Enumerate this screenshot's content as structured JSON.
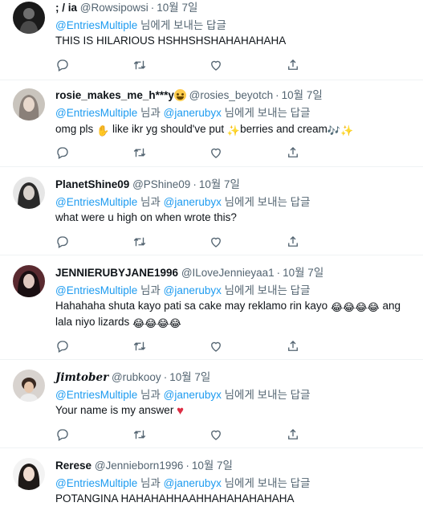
{
  "tweets": [
    {
      "name": "; / ia",
      "handle": "@Rowsipowsi",
      "date": "10월 7일",
      "reply_prefix": "",
      "reply_user1": "@EntriesMultiple",
      "reply_mid": "",
      "reply_user2": "",
      "reply_suffix": "님에게 보내는 답글",
      "text": "THIS IS HILARIOUS HSHHSHSHAHAHAHAHA"
    },
    {
      "name": "rosie_makes_me_h***y",
      "name_emoji": "grinning-sweat-emoji",
      "handle": "@rosies_beyotch",
      "date": "10월 7일",
      "reply_user1": "@EntriesMultiple",
      "reply_mid": "님과",
      "reply_user2": "@janerubyx",
      "reply_suffix": "님에게 보내는 답글",
      "text_a": "omg pls",
      "text_b": "like ikr yg should've put",
      "text_c": "berries and cream"
    },
    {
      "name": "PlanetShine09",
      "handle": "@PShine09",
      "date": "10월 7일",
      "reply_user1": "@EntriesMultiple",
      "reply_mid": "님과",
      "reply_user2": "@janerubyx",
      "reply_suffix": "님에게 보내는 답글",
      "text": "what were u high on when wrote this?"
    },
    {
      "name": "JENNIERUBYJANE1996",
      "handle": "@ILoveJennieyaa1",
      "date": "10월 7일",
      "reply_user1": "@EntriesMultiple",
      "reply_mid": "님과",
      "reply_user2": "@janerubyx",
      "reply_suffix": "님에게 보내는 답글",
      "text_a": "Hahahaha shuta kayo pati sa cake may reklamo rin kayo",
      "text_b": "ang",
      "text_c": "lala niyo lizards"
    },
    {
      "name": "𝑱𝒊𝒎𝒕𝒐𝒃𝒆𝒓",
      "handle": "@rubkooy",
      "date": "10월 7일",
      "reply_user1": "@EntriesMultiple",
      "reply_mid": "님과",
      "reply_user2": "@janerubyx",
      "reply_suffix": "님에게 보내는 답글",
      "text": "Your name is my answer"
    },
    {
      "name": "Rerese",
      "handle": "@Jennieborn1996",
      "date": "10월 7일",
      "reply_user1": "@EntriesMultiple",
      "reply_mid": "님과",
      "reply_user2": "@janerubyx",
      "reply_suffix": "님에게 보내는 답글",
      "text": "POTANGINA HAHAHAHHAAHHAHAHAHAHAHA"
    }
  ],
  "colors": {
    "link": "#1d9bf0",
    "secondary": "#536471",
    "divider": "#eff3f4",
    "heart": "#dd2e44"
  },
  "icons": [
    "reply-icon",
    "retweet-icon",
    "like-icon",
    "share-icon"
  ]
}
